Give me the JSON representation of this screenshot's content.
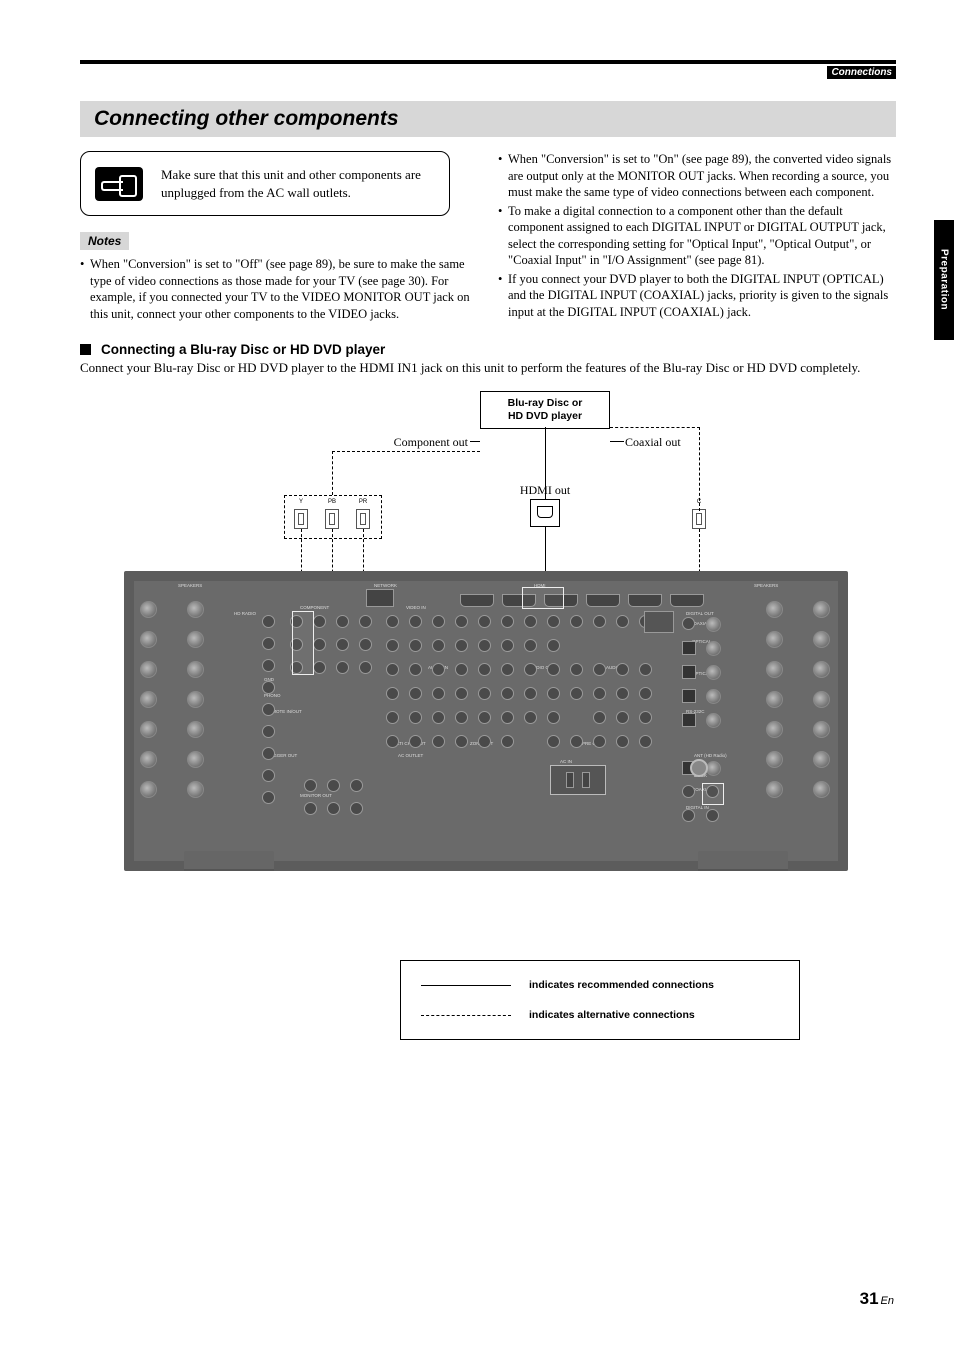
{
  "header": {
    "right_label": "Connections"
  },
  "side_tab": "Preparation",
  "section_title": "Connecting other components",
  "warning_text": "Make sure that this unit and other components are unplugged from the AC wall outlets.",
  "notes_label": "Notes",
  "notes_left": [
    "When \"Conversion\" is set to \"Off\" (see page 89), be sure to make the same type of video connections as those made for your TV (see page 30). For example, if you connected your TV to the VIDEO MONITOR OUT jack on this unit, connect your other components to the VIDEO jacks."
  ],
  "notes_right": [
    "When \"Conversion\" is set to \"On\" (see page 89), the converted video signals are output only at the MONITOR OUT jacks. When recording a source, you must make the same type of video connections between each component.",
    "To make a digital connection to a component other than the default component assigned to each DIGITAL INPUT or DIGITAL OUTPUT jack, select the corresponding setting for \"Optical Input\", \"Optical Output\", or \"Coaxial Input\" in \"I/O Assignment\" (see page 81).",
    "If you connect your DVD player to both the DIGITAL INPUT (OPTICAL) and the DIGITAL INPUT (COAXIAL) jacks, priority is given to the signals input at the DIGITAL INPUT (COAXIAL) jack."
  ],
  "subsection_title": "Connecting a Blu-ray Disc or HD DVD player",
  "subsection_body": "Connect your Blu-ray Disc or HD DVD player to the HDMI IN1 jack on this unit to perform the features of the Blu-ray Disc or HD DVD completely.",
  "diagram": {
    "device_label_line1": "Blu-ray Disc or",
    "device_label_line2": "HD DVD player",
    "comp_out": "Component out",
    "coax_out": "Coaxial out",
    "hdmi_out": "HDMI out",
    "ypbpr": [
      "Y",
      "PB",
      "PR"
    ],
    "coax_c": "C"
  },
  "legend": {
    "rec": "indicates recommended connections",
    "alt": "indicates alternative connections"
  },
  "panel_region_labels": {
    "speakers_l": "SPEAKERS",
    "speakers_r": "SPEAKERS",
    "network": "NETWORK",
    "hdmi": "HDMI",
    "video_in": "VIDEO IN",
    "out": "OUT",
    "monitor_out": "MONITOR OUT",
    "component": "COMPONENT",
    "hd_radio": "HD RADIO",
    "digital_out": "DIGITAL OUT",
    "digital_in": "DIGITAL IN",
    "audio_in": "AUDIO IN",
    "audio_out": "AUDIO OUT",
    "multich_in": "MULTI CH INPUT",
    "zone_out": "ZONE OUT",
    "pre_out": "PRE OUT",
    "ac_outlet": "AC OUTLET",
    "rs232": "RS-232C",
    "trigger": "TRIGGER OUT",
    "remote": "REMOTE IN/OUT",
    "dock": "DOCK",
    "optical": "OPTICAL",
    "coaxial": "COAXIAL",
    "phono": "PHONO",
    "gnd": "GND",
    "ac_in": "AC IN",
    "ant_hd": "ANT (HD Radio)"
  },
  "footer": {
    "page_number": "31",
    "lang": "En"
  }
}
